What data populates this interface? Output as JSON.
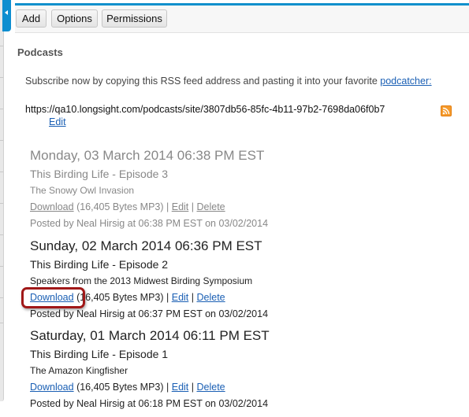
{
  "toolbar": {
    "buttons": [
      {
        "label": "Add"
      },
      {
        "label": "Options"
      },
      {
        "label": "Permissions"
      }
    ]
  },
  "page_title": "Podcasts",
  "subscribe": {
    "text": "Subscribe now by copying this RSS feed address and pasting it into your favorite ",
    "link": "podcatcher:"
  },
  "feed": {
    "url": "https://qa10.longsight.com/podcasts/site/3807db56-85fc-4b11-97b2-7698da06f0b7",
    "edit_label": "Edit",
    "icon": "rss-icon",
    "icon_color": "#f59a2c"
  },
  "episodes": [
    {
      "date": "Monday, 03 March 2014 06:38 PM EST",
      "title": "This Birding Life - Episode 3",
      "description": "The Snowy Owl Invasion",
      "download_label": "Download",
      "size": " (16,405 Bytes MP3) | ",
      "edit_label": "Edit",
      "sep": " | ",
      "delete_label": "Delete",
      "posted": "Posted by Neal Hirsig at 06:38 PM EST on 03/02/2014",
      "hidden": true
    },
    {
      "date": "Sunday, 02 March 2014 06:36 PM EST",
      "title": "This Birding Life - Episode 2",
      "description": "Speakers from the 2013 Midwest Birding Symposium",
      "download_label": "Download",
      "size": " (16,405 Bytes MP3) | ",
      "edit_label": "Edit",
      "sep": " | ",
      "delete_label": "Delete",
      "posted": "Posted by Neal Hirsig at 06:37 PM EST on 03/02/2014",
      "hidden": false
    },
    {
      "date": "Saturday, 01 March 2014 06:11 PM EST",
      "title": "This Birding Life - Episode 1",
      "description": "The Amazon Kingfisher",
      "download_label": "Download",
      "size": " (16,405 Bytes MP3) | ",
      "edit_label": "Edit",
      "sep": " | ",
      "delete_label": "Delete",
      "posted": "Posted by Neal Hirsig at 06:18 PM EST on 03/02/2014",
      "hidden": false
    }
  ],
  "colors": {
    "accent": "#1090cc",
    "link": "#1a5fb4",
    "highlight": "#a01818"
  }
}
